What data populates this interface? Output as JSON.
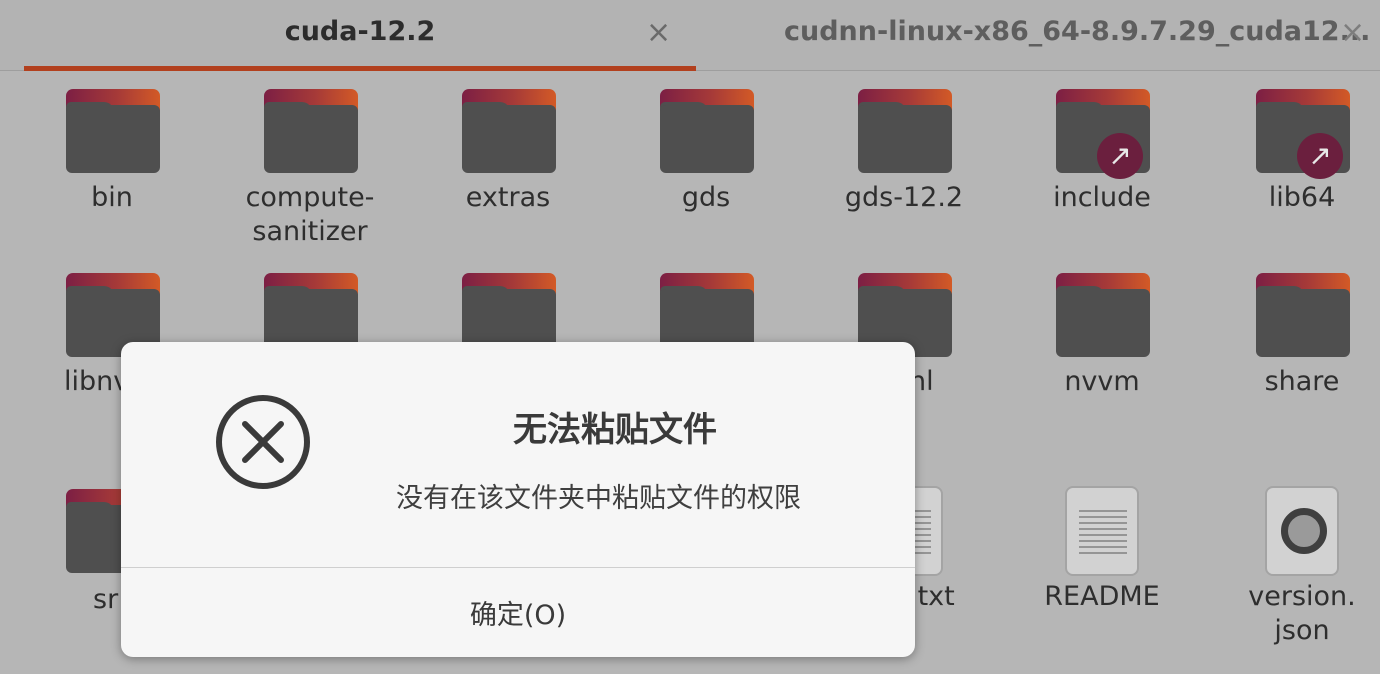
{
  "tabs": [
    {
      "label": "cuda-12.2",
      "close": "×",
      "active": true
    },
    {
      "label": "cudnn-linux-x86_64-8.9.7.29_cuda12...",
      "close": "×",
      "active": false
    }
  ],
  "colors": {
    "accent": "#b2401e",
    "folder_front": "#4f4f4f",
    "folder_tab_start": "#7c1f44",
    "folder_tab_end": "#d35a26",
    "link_badge": "#6b1f3e"
  },
  "files": {
    "row1": [
      "bin",
      "compute-\nsanitizer",
      "extras",
      "gds",
      "gds-12.2",
      "include",
      "lib64"
    ],
    "row2_visible": [
      "libnv",
      "nl",
      "nvvm",
      "share"
    ],
    "row3_visible": [
      "sr",
      ".txt",
      "README",
      "version.\njson"
    ]
  },
  "icons": {
    "folder": "folder-icon",
    "symlink": "link-arrow-icon",
    "text_file": "text-file-icon",
    "json_file": "json-file-icon",
    "error": "error-circle-x-icon"
  },
  "dialog": {
    "title": "无法粘贴文件",
    "message": "没有在该文件夹中粘贴文件的权限",
    "ok_label": "确定(O)"
  }
}
